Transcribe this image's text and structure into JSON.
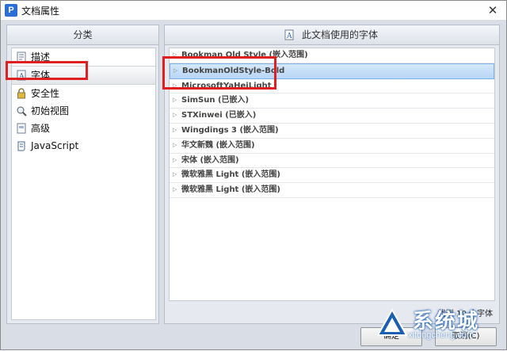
{
  "window": {
    "title": "文档属性",
    "app_icon_letter": "P",
    "close_glyph": "✕"
  },
  "left_panel": {
    "header": "分类",
    "items": [
      {
        "label": "描述",
        "icon": "document-icon",
        "selected": false
      },
      {
        "label": "字体",
        "icon": "font-icon",
        "selected": true
      },
      {
        "label": "安全性",
        "icon": "lock-icon",
        "selected": false
      },
      {
        "label": "初始视图",
        "icon": "magnifier-icon",
        "selected": false
      },
      {
        "label": "高级",
        "icon": "page-icon",
        "selected": false
      },
      {
        "label": "JavaScript",
        "icon": "script-icon",
        "selected": false
      }
    ]
  },
  "right_panel": {
    "header": "此文档使用的字体",
    "fonts": [
      {
        "label": "Bookman Old Style (嵌入范围)",
        "selected": false
      },
      {
        "label": "BookmanOldStyle-Bold",
        "selected": true
      },
      {
        "label": "MicrosoftYaHeiLight",
        "selected": false
      },
      {
        "label": "SimSun (已嵌入)",
        "selected": false
      },
      {
        "label": "STXinwei (已嵌入)",
        "selected": false
      },
      {
        "label": "Wingdings 3 (嵌入范围)",
        "selected": false
      },
      {
        "label": "华文新魏 (嵌入范围)",
        "selected": false
      },
      {
        "label": "宋体 (嵌入范围)",
        "selected": false
      },
      {
        "label": "微软雅黑 Light (嵌入范围)",
        "selected": false
      },
      {
        "label": "微软雅黑 Light (嵌入范围)",
        "selected": false
      }
    ],
    "found_text": "找到 10 个字体"
  },
  "buttons": {
    "ok": "确定",
    "cancel": "取消(C)"
  },
  "watermark": {
    "name": "系统城",
    "url": "xitongcheng.com"
  },
  "colors": {
    "highlight": "#e02020",
    "selection": "#b8d6f5",
    "client_bg": "#d9dde5"
  }
}
